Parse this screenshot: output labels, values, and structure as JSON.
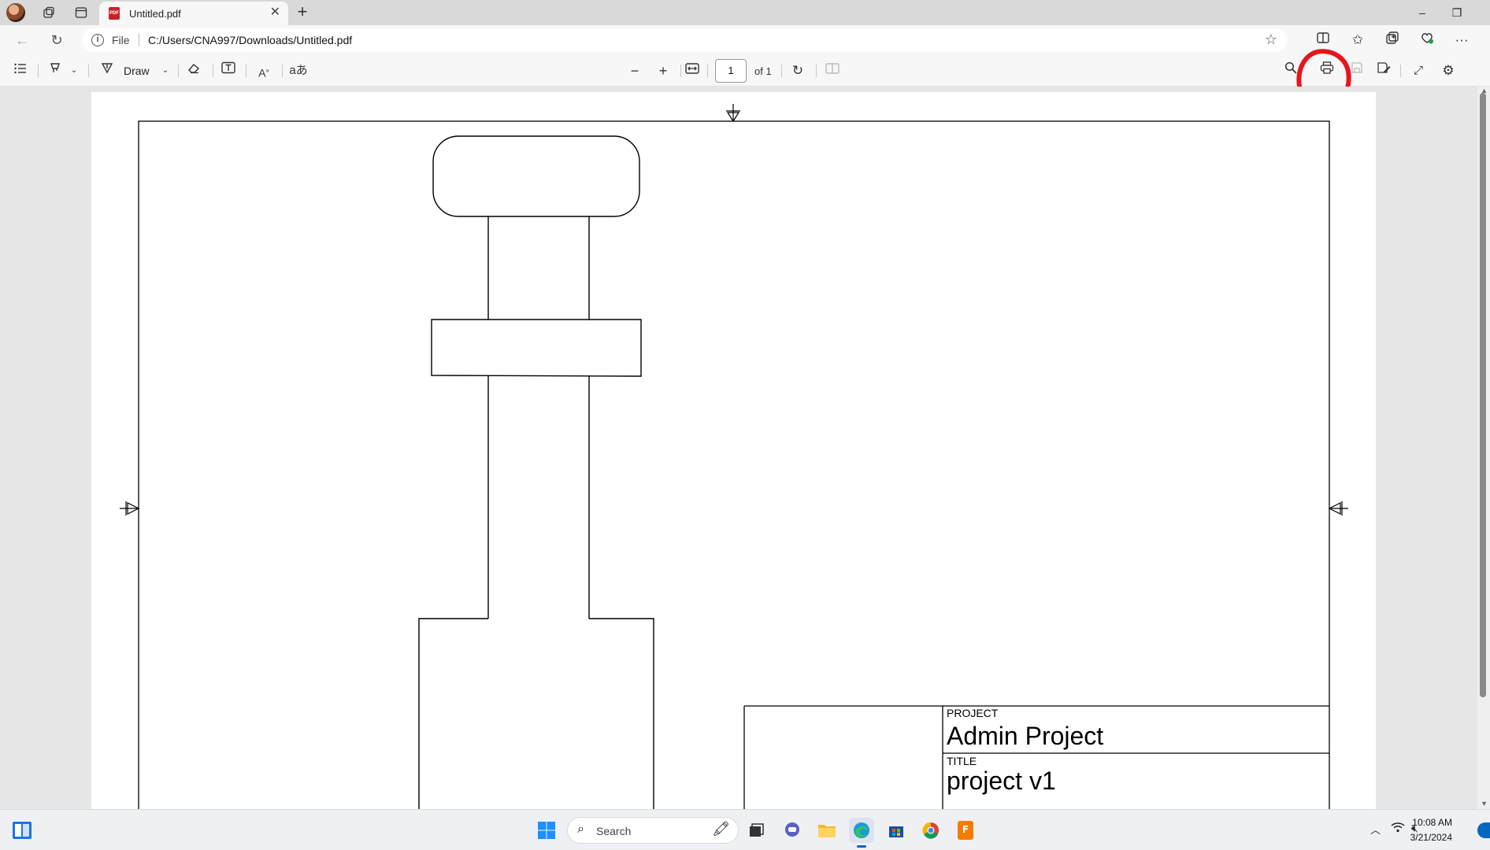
{
  "browser": {
    "tab_title": "Untitled.pdf",
    "new_tab_symbol": "+",
    "address": {
      "scheme_label": "File",
      "url": "C:/Users/CNA997/Downloads/Untitled.pdf"
    },
    "window_controls": {
      "minimize": "–",
      "restore": "❐"
    }
  },
  "pdf_toolbar": {
    "draw_label": "Draw",
    "page_current": "1",
    "page_total_label": "of 1",
    "highlighted_tool": "print-icon",
    "annotation_color": "#e8141c"
  },
  "document": {
    "title_block": {
      "project_label": "PROJECT",
      "project_value": "Admin Project",
      "title_label": "TITLE",
      "title_value": "project v1"
    }
  },
  "taskbar": {
    "search_placeholder": "Search",
    "time": "10:08 AM",
    "date": "3/21/2024"
  },
  "colors": {
    "accent_blue": "#0067c0",
    "pdf_red": "#c8202a"
  }
}
